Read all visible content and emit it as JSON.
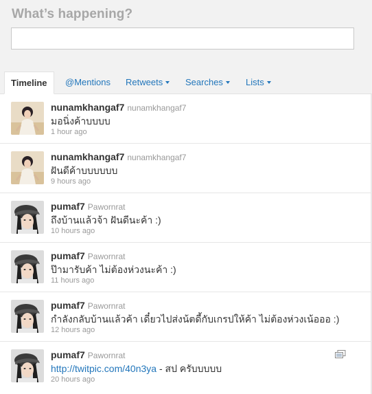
{
  "composer": {
    "title": "What’s happening?",
    "value": ""
  },
  "tabs": [
    {
      "label": "Timeline",
      "active": true
    },
    {
      "label": "@Mentions",
      "active": false
    },
    {
      "label": "Retweets",
      "active": false,
      "dropdown": true
    },
    {
      "label": "Searches",
      "active": false,
      "dropdown": true
    },
    {
      "label": "Lists",
      "active": false,
      "dropdown": true
    }
  ],
  "colors": {
    "link": "#2276bb",
    "text": "#333333",
    "muted": "#999999",
    "composer_bg": "#f2f2f2"
  },
  "tweets": [
    {
      "screen_name": "nunamkhangaf7",
      "full_name": "nunamkhangaf7",
      "avatar": "girl-avatar-icon",
      "text": "มอนิ่งค้าบบบบ",
      "time": "1 hour ago"
    },
    {
      "screen_name": "nunamkhangaf7",
      "full_name": "nunamkhangaf7",
      "avatar": "girl-avatar-icon",
      "text": "ฝันดีค้าบบบบบบ",
      "time": "9 hours ago"
    },
    {
      "screen_name": "pumaf7",
      "full_name": "Pawornrat",
      "avatar": "girl-cap-avatar-icon",
      "text": "ถึงบ้านแล้วจ้า ฝันดีนะค้า :)",
      "time": "10 hours ago"
    },
    {
      "screen_name": "pumaf7",
      "full_name": "Pawornrat",
      "avatar": "girl-cap-avatar-icon",
      "text": "ป๊ามารับค้า ไม่ต้องห่วงนะค้า :)",
      "time": "11 hours ago"
    },
    {
      "screen_name": "pumaf7",
      "full_name": "Pawornrat",
      "avatar": "girl-cap-avatar-icon",
      "text": "กำลังกลับบ้านแล้วค้า เดี๋ยวไปส่งน้ตดี้กับเกรปให้ค้า ไม่ต้องห่วงเน้อออ :)",
      "time": "12 hours ago"
    },
    {
      "screen_name": "pumaf7",
      "full_name": "Pawornrat",
      "avatar": "girl-cap-avatar-icon",
      "link": "http://twitpic.com/40n3ya",
      "text": " - สป ครับบบบบ",
      "time": "20 hours ago",
      "media_icon": "photo-gallery-icon"
    }
  ]
}
